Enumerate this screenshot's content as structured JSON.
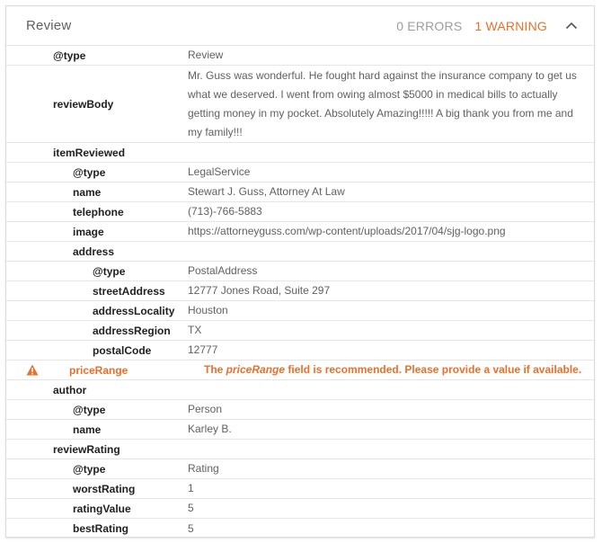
{
  "header": {
    "title": "Review",
    "errors": "0 ERRORS",
    "warnings": "1 WARNING"
  },
  "colors": {
    "warning": "#e8702a",
    "errors_muted": "#9e9e9e"
  },
  "rows": {
    "type": {
      "key": "@type",
      "value": "Review"
    },
    "reviewBody": {
      "key": "reviewBody",
      "value": "Mr. Guss was wonderful. He fought hard against the insurance company to get us what we deserved. I went from owing almost $5000 in medical bills to actually getting money in my pocket. Absolutely Amazing!!!!! A big thank you from me and my family!!!"
    },
    "itemReviewed": {
      "key": "itemReviewed"
    },
    "ir_type": {
      "key": "@type",
      "value": "LegalService"
    },
    "ir_name": {
      "key": "name",
      "value": "Stewart J. Guss, Attorney At Law"
    },
    "ir_telephone": {
      "key": "telephone",
      "value": "(713)-766-5883"
    },
    "ir_image": {
      "key": "image",
      "value": "https://attorneyguss.com/wp-content/uploads/2017/04/sjg-logo.png"
    },
    "ir_address": {
      "key": "address"
    },
    "addr_type": {
      "key": "@type",
      "value": "PostalAddress"
    },
    "addr_street": {
      "key": "streetAddress",
      "value": "12777 Jones Road, Suite 297"
    },
    "addr_locality": {
      "key": "addressLocality",
      "value": "Houston"
    },
    "addr_region": {
      "key": "addressRegion",
      "value": "TX"
    },
    "addr_postal": {
      "key": "postalCode",
      "value": "12777"
    },
    "priceRange": {
      "key": "priceRange",
      "msg_prefix": "The ",
      "msg_field": "priceRange",
      "msg_suffix": " field is recommended. Please provide a value if available.",
      "icon": "warning-triangle-icon"
    },
    "author": {
      "key": "author"
    },
    "au_type": {
      "key": "@type",
      "value": "Person"
    },
    "au_name": {
      "key": "name",
      "value": "Karley B."
    },
    "reviewRating": {
      "key": "reviewRating"
    },
    "rr_type": {
      "key": "@type",
      "value": "Rating"
    },
    "rr_worst": {
      "key": "worstRating",
      "value": "1"
    },
    "rr_value": {
      "key": "ratingValue",
      "value": "5"
    },
    "rr_best": {
      "key": "bestRating",
      "value": "5"
    }
  }
}
